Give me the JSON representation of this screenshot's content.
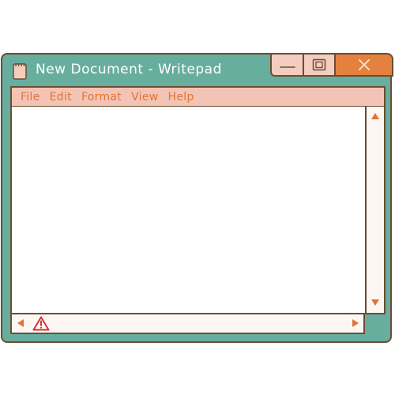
{
  "window": {
    "title": "New Document - Writepad"
  },
  "menu": {
    "items": [
      "File",
      "Edit",
      "Format",
      "View",
      "Help"
    ]
  },
  "editor": {
    "content": ""
  },
  "icons": {
    "document": "notepad-icon",
    "minimize": "minimize-icon",
    "maximize": "restore-icon",
    "close": "close-icon",
    "warning": "warning-icon",
    "scroll_up": "arrow-up-icon",
    "scroll_down": "arrow-down-icon",
    "scroll_left": "arrow-left-icon",
    "scroll_right": "arrow-right-icon"
  },
  "colors": {
    "window_frame": "#67ae9f",
    "outline": "#6b4d32",
    "menubar": "#f3c4b6",
    "menu_text": "#e07434",
    "close_button": "#e5813e",
    "title_buttons": "#f3cdbf",
    "warning": "#d6322f"
  }
}
